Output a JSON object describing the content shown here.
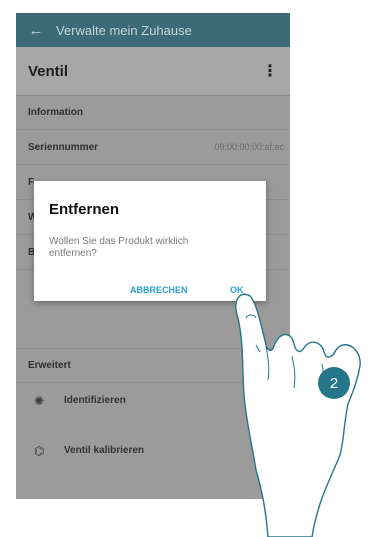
{
  "appbar": {
    "back_icon": "arrow-left-icon",
    "title": "Verwalte mein Zuhause"
  },
  "device": {
    "name": "Ventil",
    "menu_icon": "kebab-menu-icon"
  },
  "info": {
    "section_label": "Information",
    "serial_label": "Seriennummer",
    "serial_value": "09:00:00:00:af:ec",
    "hidden_row1_prefix": "F",
    "hidden_row2_prefix": "W",
    "hidden_row3_prefix": "B"
  },
  "advanced": {
    "section_label": "Erweitert",
    "items": [
      {
        "label": "Identifizieren",
        "icon": "light-bulb-icon"
      },
      {
        "label": "Ventil kalibrieren",
        "icon": "calibrate-icon"
      }
    ]
  },
  "dialog": {
    "title": "Entfernen",
    "message": "Wollen Sie das Produkt wirklich entfernen?",
    "cancel_label": "ABBRECHEN",
    "ok_label": "OK"
  },
  "step_badge": "2",
  "colors": {
    "appbar": "#3d6a77",
    "accent": "#2a9fd0",
    "badge": "#25768a"
  }
}
